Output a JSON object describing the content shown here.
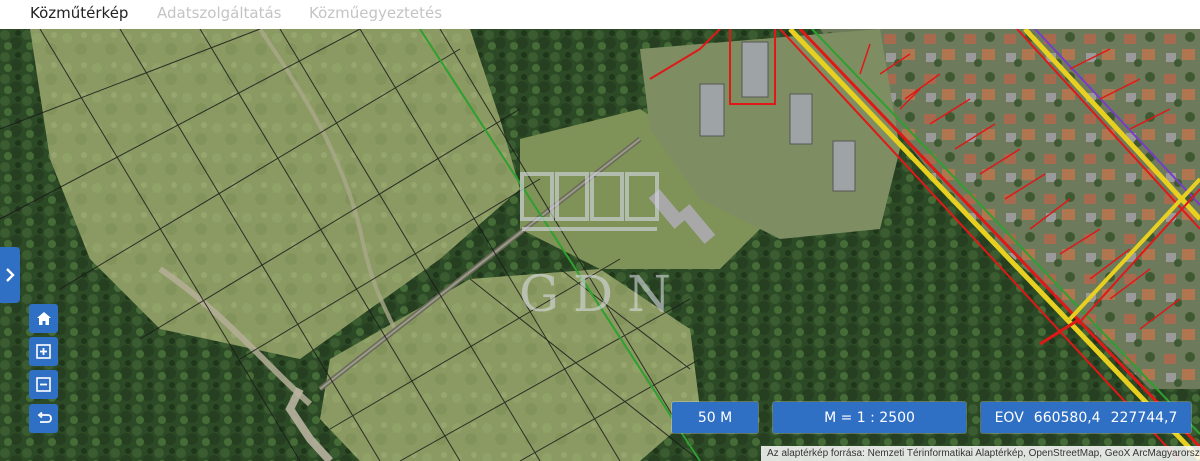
{
  "tabs": [
    {
      "label": "Közműtérkép",
      "active": true
    },
    {
      "label": "Adatszolgáltatás",
      "active": false
    },
    {
      "label": "Közműegyeztetés",
      "active": false
    }
  ],
  "controls": {
    "side_toggle_icon": "chevron-right-icon",
    "home_icon": "home-icon",
    "zoom_in_icon": "zoom-in-icon",
    "zoom_out_icon": "zoom-out-icon",
    "back_icon": "undo-icon"
  },
  "status": {
    "scale_bar": "50 M",
    "map_scale": "M = 1 : 2500",
    "eov_label": "EOV",
    "eov_x": "660580,4",
    "eov_y": "227744,7"
  },
  "attribution": "Az alaptérkép forrása: Nemzeti Térinformatikai Alaptérkép, OpenStreetMap, GeoX ArcMagyarország",
  "watermark": "GDN",
  "colors": {
    "accent": "#2f6fc4",
    "utility_line_red": "#e01818",
    "utility_line_yellow": "#e8d020",
    "utility_line_green": "#2fa02f",
    "utility_line_purple": "#7a3cc8",
    "parcel_line": "#1a1a1a"
  }
}
